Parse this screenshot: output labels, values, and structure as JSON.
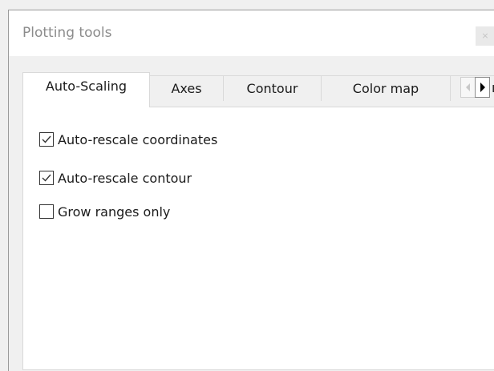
{
  "window": {
    "title": "Plotting tools",
    "close_glyph": "×"
  },
  "tabs": [
    {
      "label": "Auto-Scaling",
      "active": true
    },
    {
      "label": "Axes",
      "active": false
    },
    {
      "label": "Contour",
      "active": false
    },
    {
      "label": "Color map",
      "active": false
    }
  ],
  "tab_overflow": {
    "partial_text": "ı",
    "left_arrow_icon": "triangle-left-icon",
    "right_arrow_icon": "triangle-right-icon"
  },
  "options": [
    {
      "label": "Auto-rescale coordinates",
      "checked": true
    },
    {
      "label": "Auto-rescale contour",
      "checked": true
    },
    {
      "label": "Grow ranges only",
      "checked": false
    }
  ]
}
